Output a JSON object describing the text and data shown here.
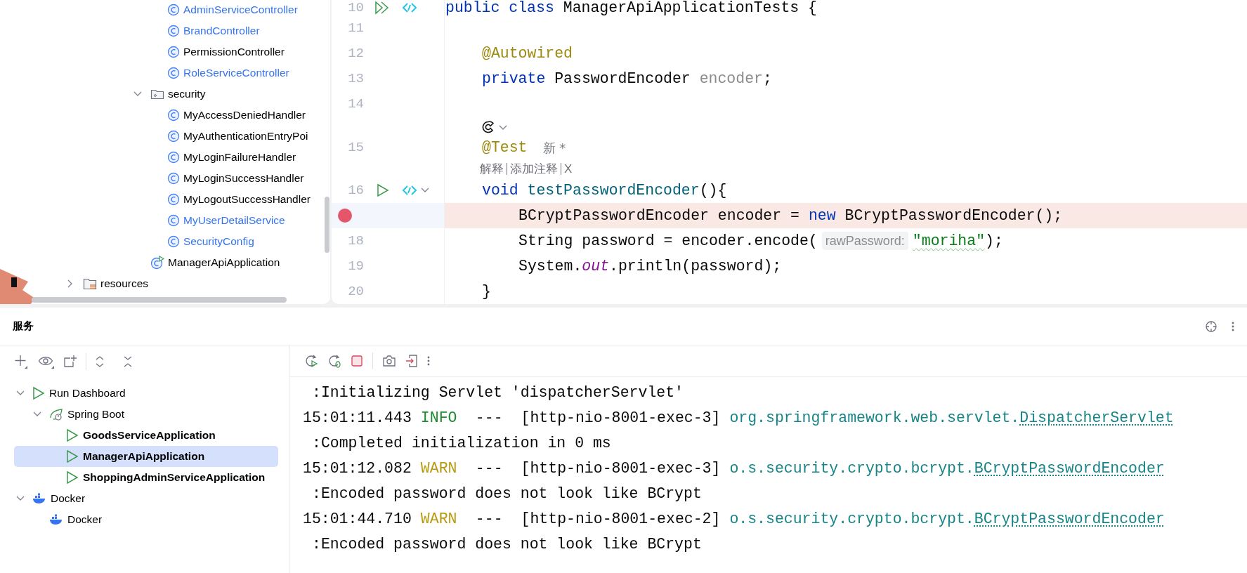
{
  "project_tree": [
    {
      "children": [
        {
          "children": [
            {
              "children": [
                {
                  "children": [
                    {
                      "children": [
                        {
                          "label": "AdminServiceController",
                          "kind": "class",
                          "modified": true
                        },
                        {
                          "label": "BrandController",
                          "kind": "class",
                          "modified": true
                        },
                        {
                          "label": "PermissionController",
                          "kind": "class",
                          "modified": false
                        },
                        {
                          "label": "RoleServiceController",
                          "kind": "class",
                          "modified": true
                        }
                      ]
                    },
                    {
                      "label": "security",
                      "kind": "folder",
                      "expanded": true,
                      "children": [
                        {
                          "label": "MyAccessDeniedHandler",
                          "kind": "class",
                          "modified": false
                        },
                        {
                          "label": "MyAuthenticationEntryPoi",
                          "kind": "class",
                          "modified": false
                        },
                        {
                          "label": "MyLoginFailureHandler",
                          "kind": "class",
                          "modified": false
                        },
                        {
                          "label": "MyLoginSuccessHandler",
                          "kind": "class",
                          "modified": false
                        },
                        {
                          "label": "MyLogoutSuccessHandler",
                          "kind": "class",
                          "modified": false
                        },
                        {
                          "label": "MyUserDetailService",
                          "kind": "class",
                          "modified": true
                        },
                        {
                          "label": "SecurityConfig",
                          "kind": "class",
                          "modified": true
                        }
                      ]
                    },
                    {
                      "label": "ManagerApiApplication",
                      "kind": "app",
                      "modified": false
                    }
                  ]
                }
              ]
            }
          ]
        }
      ]
    },
    {
      "label": "resources",
      "kind": "resources",
      "expanded": false
    }
  ],
  "editor": {
    "lines": [
      {
        "kind": "code",
        "number": "10",
        "run_all": true,
        "breakpoint": false,
        "tokens": [
          {
            "text": "public class ",
            "kind": "keyword"
          },
          {
            "text": "ManagerApiApplicationTests {",
            "kind": "plain"
          }
        ],
        "children": [
          {
            "kind": "code",
            "number": "11",
            "breakpoint": false
          },
          {
            "kind": "code",
            "number": "12",
            "breakpoint": false,
            "tokens": [
              {
                "text": "@Autowired",
                "kind": "annotation"
              }
            ]
          },
          {
            "kind": "code",
            "number": "13",
            "breakpoint": false,
            "tokens": [
              {
                "text": "private ",
                "kind": "keyword"
              },
              {
                "text": "PasswordEncoder ",
                "kind": "plain"
              },
              {
                "text": "encoder",
                "kind": "unused"
              },
              {
                "text": ";",
                "kind": "plain"
              }
            ]
          },
          {
            "kind": "code",
            "number": "14",
            "breakpoint": false
          },
          {
            "kind": "assistant"
          },
          {
            "kind": "code",
            "number": "15",
            "breakpoint": false,
            "tokens": [
              {
                "text": "@Test",
                "kind": "annotation"
              }
            ],
            "author": "新 *"
          },
          {
            "kind": "actions",
            "items": [
              "解释",
              "添加注释",
              "X"
            ]
          },
          {
            "kind": "code",
            "number": "16",
            "run": true,
            "breakpoint": false,
            "tokens": [
              {
                "text": "void ",
                "kind": "keyword"
              },
              {
                "text": "testPasswordEncoder",
                "kind": "method"
              },
              {
                "text": "(){",
                "kind": "plain"
              }
            ],
            "children": [
              {
                "kind": "code",
                "breakpoint": true,
                "tokens": [
                  {
                    "text": "BCryptPasswordEncoder encoder = ",
                    "kind": "plain"
                  },
                  {
                    "text": "new",
                    "kind": "keyword"
                  },
                  {
                    "text": " BCryptPasswordEncoder();",
                    "kind": "plain"
                  }
                ]
              },
              {
                "kind": "code",
                "number": "18",
                "breakpoint": false,
                "tokens": [
                  {
                    "text": "String password = encoder.encode(",
                    "kind": "plain"
                  },
                  {
                    "text": "rawPassword:",
                    "kind": "hint"
                  },
                  {
                    "text": "\"moriha\"",
                    "kind": "string",
                    "typo": true
                  },
                  {
                    "text": ");",
                    "kind": "plain"
                  }
                ]
              },
              {
                "kind": "code",
                "number": "19",
                "breakpoint": false,
                "tokens": [
                  {
                    "text": "System.",
                    "kind": "plain"
                  },
                  {
                    "text": "out",
                    "kind": "static"
                  },
                  {
                    "text": ".println(password);",
                    "kind": "plain"
                  }
                ]
              }
            ]
          },
          {
            "kind": "code",
            "number": "20",
            "breakpoint": false,
            "tokens": [
              {
                "text": "}",
                "kind": "plain"
              }
            ]
          }
        ]
      }
    ]
  },
  "services": {
    "title": "服务",
    "tree": [
      {
        "label": "Run Dashboard",
        "kind": "dashboard",
        "expanded": true,
        "selected": false,
        "children": [
          {
            "label": "Spring Boot",
            "kind": "spring",
            "expanded": true,
            "selected": false,
            "children": [
              {
                "label": "GoodsServiceApplication",
                "kind": "app",
                "selected": false
              },
              {
                "label": "ManagerApiApplication",
                "kind": "app",
                "selected": true
              },
              {
                "label": "ShoppingAdminServiceApplication",
                "kind": "app",
                "selected": false
              }
            ]
          }
        ]
      },
      {
        "label": "Docker",
        "kind": "docker",
        "expanded": true,
        "selected": false,
        "children": [
          {
            "label": "Docker",
            "kind": "docker",
            "selected": false
          }
        ]
      }
    ],
    "console": [
      {
        "kind": "message",
        "text": ":Initializing Servlet 'dispatcherServlet'"
      },
      {
        "kind": "log",
        "time": "15:01:11.443",
        "level": "INFO",
        "dashes": "---",
        "thread": "[http-nio-8001-exec-3]",
        "package": "org.springframework.web.servlet.",
        "class": "DispatcherServlet"
      },
      {
        "kind": "message",
        "text": ":Completed initialization in 0 ms"
      },
      {
        "kind": "log",
        "time": "15:01:12.082",
        "level": "WARN",
        "dashes": "---",
        "thread": "[http-nio-8001-exec-3]",
        "package": "o.s.security.crypto.bcrypt.",
        "class": "BCryptPasswordEncoder"
      },
      {
        "kind": "message",
        "text": ":Encoded password does not look like BCrypt"
      },
      {
        "kind": "log",
        "time": "15:01:44.710",
        "level": "WARN",
        "dashes": "---",
        "thread": "[http-nio-8001-exec-2]",
        "package": "o.s.security.crypto.bcrypt.",
        "class": "BCryptPasswordEncoder"
      },
      {
        "kind": "message",
        "text": ":Encoded password does not look like BCrypt"
      }
    ]
  }
}
